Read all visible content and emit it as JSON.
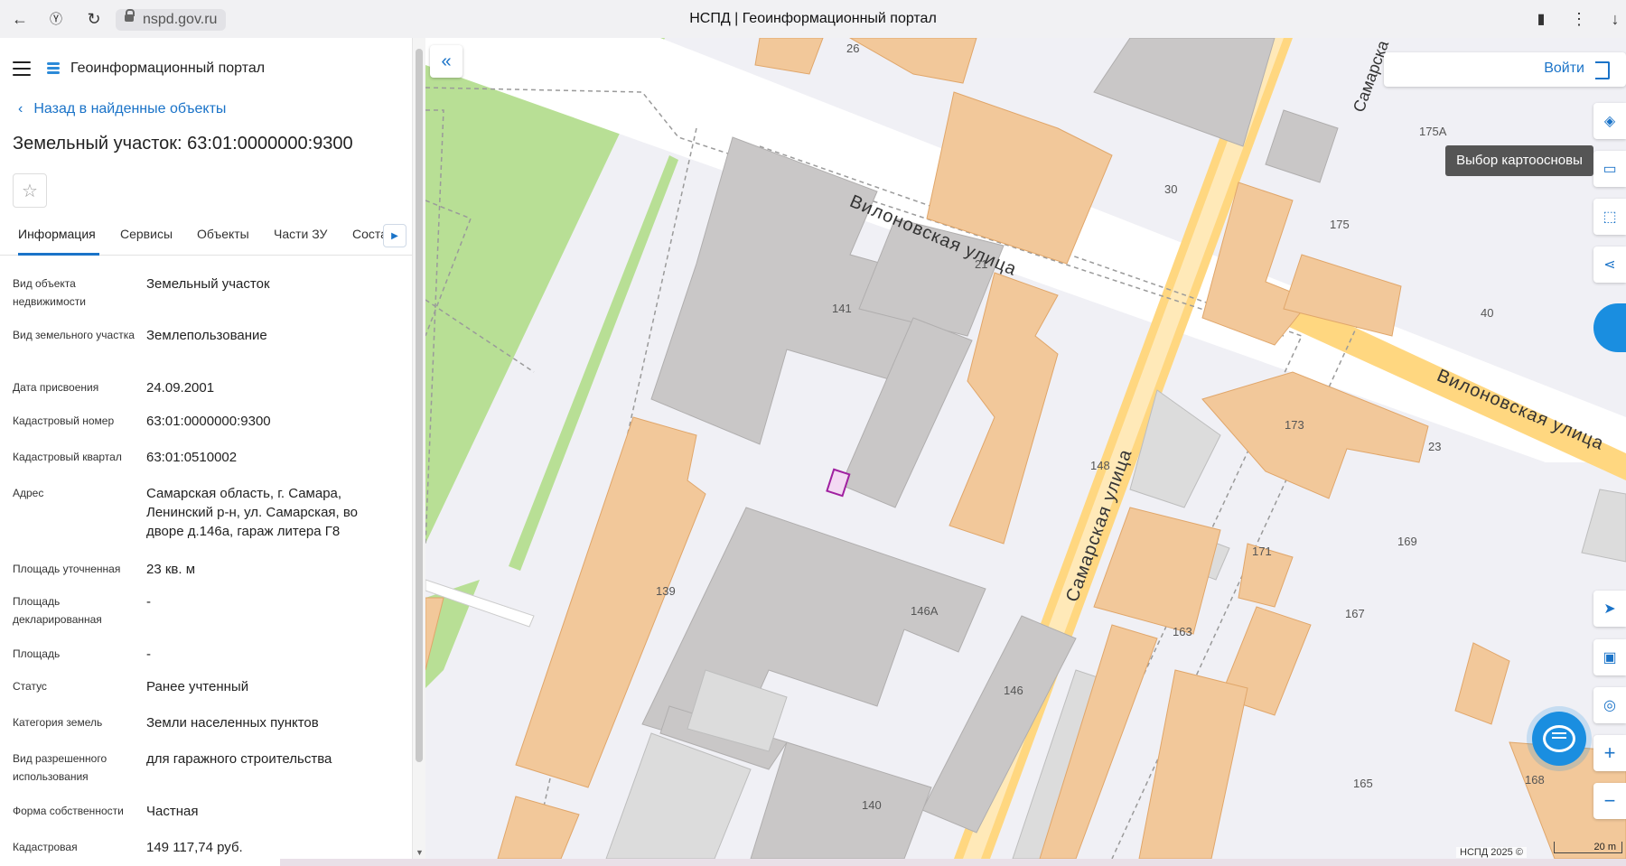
{
  "browser": {
    "url": "nspd.gov.ru",
    "tab_title": "НСПД | Геоинформационный портал"
  },
  "app": {
    "name": "Геоинформационный портал"
  },
  "sidebar": {
    "back_link": "Назад в найденные объекты",
    "title": "Земельный участок: 63:01:0000000:9300",
    "tabs": [
      "Информация",
      "Сервисы",
      "Объекты",
      "Части ЗУ",
      "Соста"
    ],
    "rows": [
      {
        "label": "Вид объекта недвижимости",
        "value": "Земельный участок"
      },
      {
        "label": "Вид земельного участка",
        "value": "Землепользование"
      },
      {
        "label": "Дата присвоения",
        "value": "24.09.2001"
      },
      {
        "label": "Кадастровый номер",
        "value": "63:01:0000000:9300"
      },
      {
        "label": "Кадастровый квартал",
        "value": "63:01:0510002"
      },
      {
        "label": "Адрес",
        "value": "Самарская область, г. Самара, Ленинский р-н, ул. Самарская, во дворе д.146а, гараж литера Г8"
      },
      {
        "label": "Площадь уточненная",
        "value": "23 кв. м"
      },
      {
        "label": "Площадь декларированная",
        "value": "-"
      },
      {
        "label": "Площадь",
        "value": "-"
      },
      {
        "label": "Статус",
        "value": "Ранее учтенный"
      },
      {
        "label": "Категория земель",
        "value": "Земли населенных пунктов"
      },
      {
        "label": "Вид разрешенного использования",
        "value": "для гаражного строительства"
      },
      {
        "label": "Форма собственности",
        "value": "Частная"
      },
      {
        "label": "Кадастровая",
        "value": "149 117,74 руб."
      }
    ]
  },
  "map": {
    "login": "Войти",
    "tooltip": "Выбор картоосновы",
    "attribution": "НСПД 2025 ©",
    "scale": "20 m",
    "streets": [
      "Вилоновская улица",
      "Вилоновская улица",
      "Самарская улица",
      "Самарска"
    ],
    "labels": [
      "26",
      "30",
      "21",
      "141",
      "175А",
      "175",
      "40",
      "173",
      "23",
      "148",
      "139",
      "169",
      "171",
      "146А",
      "167",
      "163",
      "146",
      "165",
      "168",
      "140"
    ]
  },
  "colors": {
    "accent": "#1a73c8",
    "building_orange": "#f2c89a",
    "building_gray": "#c9c7c7",
    "park": "#b8df95",
    "road": "#ffd780"
  }
}
